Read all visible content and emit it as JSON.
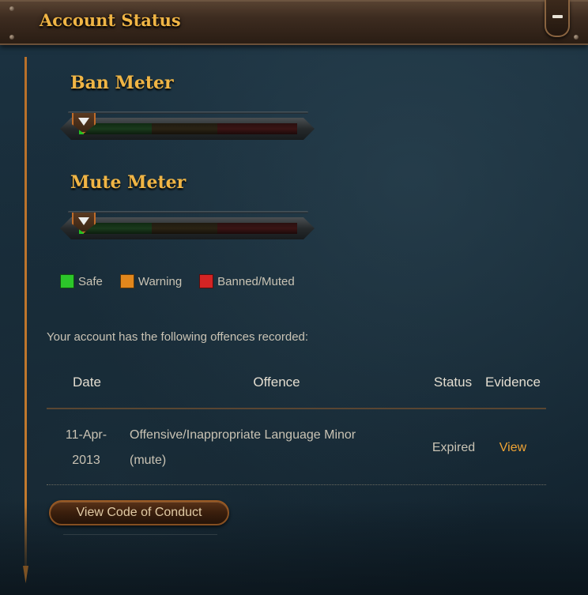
{
  "header": {
    "title": "Account Status",
    "collapse_label": ""
  },
  "ban_meter": {
    "title": "Ban Meter",
    "level": 0.02
  },
  "mute_meter": {
    "title": "Mute Meter",
    "level": 0.02
  },
  "legend": [
    {
      "label": "Safe",
      "color": "#2cc62a"
    },
    {
      "label": "Warning",
      "color": "#e2871c"
    },
    {
      "label": "Banned/Muted",
      "color": "#d42424"
    }
  ],
  "intro_text": "Your account has the following offences recorded:",
  "table": {
    "headers": [
      "Date",
      "Offence",
      "Status",
      "Evidence"
    ],
    "rows": [
      {
        "date_line1": "11-Apr-",
        "date_line2": "2013",
        "offence_line1": "Offensive/Inappropriate Language Minor",
        "offence_line2": "(mute)",
        "status": "Expired",
        "evidence": "View"
      }
    ]
  },
  "buttons": {
    "code_of_conduct": "View Code of Conduct"
  },
  "colors": {
    "accent": "#f0b545",
    "link": "#f0a434",
    "background": "#172b38"
  }
}
